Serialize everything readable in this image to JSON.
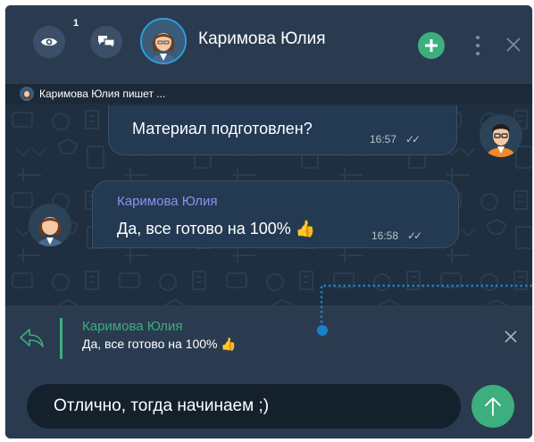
{
  "header": {
    "views_count": "1",
    "contact_name": "Каримова Юлия",
    "icons": [
      "eye-icon",
      "chat-bubbles-icon",
      "plus-icon",
      "more-vertical-icon",
      "close-icon"
    ]
  },
  "typing_indicator": {
    "text": "Каримова Юлия пишет ..."
  },
  "messages": [
    {
      "direction": "outgoing",
      "text": "Материал подготовлен?",
      "time": "16:57",
      "status": "✓✓"
    },
    {
      "direction": "incoming",
      "sender": "Каримова Юлия",
      "text": "Да, все готово на 100% 👍",
      "time": "16:58",
      "status": "✓✓"
    }
  ],
  "reply_preview": {
    "sender": "Каримова Юлия",
    "text": "Да, все готово на 100% 👍"
  },
  "composer": {
    "value": "Отлично, тогда начинаем ;)"
  },
  "colors": {
    "accent_green": "#3dae7d",
    "sender_name": "#8f8ff0",
    "avatar_ring": "#2aa0d8",
    "connector": "#1b7fc9"
  }
}
